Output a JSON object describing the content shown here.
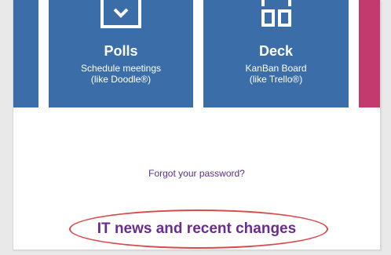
{
  "tiles": [
    {
      "title": "Polls",
      "description_line1": "Schedule meetings",
      "description_line2": "(like Doodle®)",
      "icon": "poll-calendar-icon"
    },
    {
      "title": "Deck",
      "description_line1": "KanBan Board",
      "description_line2": "(like Trello®)",
      "icon": "deck-board-icon"
    }
  ],
  "login": {
    "forgot_password": "Forgot your password?"
  },
  "news": {
    "link_label": "IT news and recent changes"
  },
  "colors": {
    "tile_blue": "#3b6ea9",
    "tile_magenta": "#c23a6e",
    "link_purple": "#5a2f8c",
    "highlight_red": "#d94a4a"
  }
}
